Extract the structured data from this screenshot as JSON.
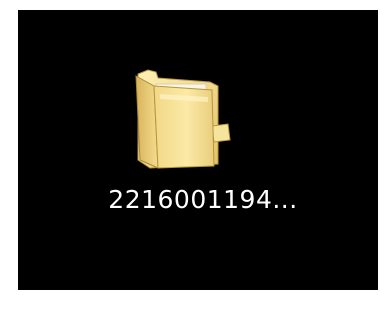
{
  "desktop": {
    "background_color": "#000000",
    "items": [
      {
        "type": "folder",
        "icon": "folder-icon",
        "label": "2216001194..."
      }
    ]
  }
}
